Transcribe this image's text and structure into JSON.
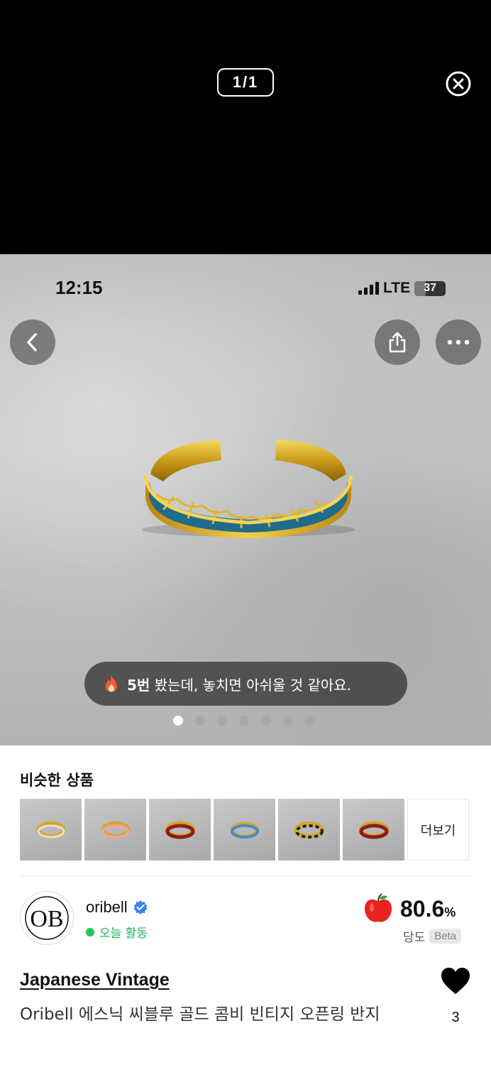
{
  "viewer": {
    "counter": "1/1"
  },
  "status_bar": {
    "time": "12:15",
    "network": "LTE",
    "battery": "37"
  },
  "photo": {
    "toast_count": "5번",
    "toast_text": " 봤는데, 놓치면 아쉬울 것 같아요.",
    "dots_total": 7,
    "dots_active": 1
  },
  "similar": {
    "title": "비슷한 상품",
    "more_label": "더보기",
    "thumbnails": [
      {
        "ring_color": "#e8e0d2"
      },
      {
        "ring_color": "#e9a6a0"
      },
      {
        "ring_color": "#8b1d1d"
      },
      {
        "ring_color": "#3e8fc9"
      },
      {
        "ring_color": "#222222"
      },
      {
        "ring_color": "#8b1d1d"
      }
    ]
  },
  "seller": {
    "name": "oribell",
    "logo_text": "OB",
    "activity": "오늘 활동",
    "score_value": "80.6",
    "score_unit": "%",
    "score_label": "당도",
    "beta_label": "Beta",
    "accent_color": "#22c55e",
    "verified_color": "#3b82f6"
  },
  "product": {
    "brand": "Japanese Vintage",
    "title": "Oribell 에스닉 씨블루 골드 콤비 빈티지 오픈링 반지",
    "likes": "3"
  }
}
